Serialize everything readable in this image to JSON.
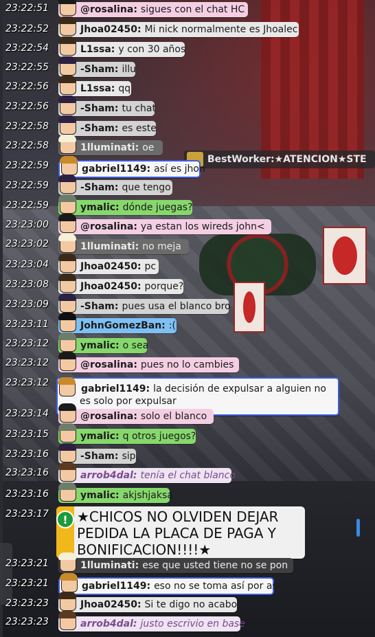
{
  "overlay": {
    "bestworker_name": "BestWorker:",
    "bestworker_msg": "★ATENCION★STE"
  },
  "rows": [
    {
      "time": "23:22:51",
      "name": "@rosalina:",
      "msg": "sigues con el chat HC",
      "style": "b-pink"
    },
    {
      "time": "23:22:52",
      "name": "Jhoa02450:",
      "msg": "Mi nick normalmente es Jhoalec",
      "style": "b-lgrey"
    },
    {
      "time": "23:22:54",
      "name": "L1ssa:",
      "msg": "y con 30 años",
      "style": "b-lgrey"
    },
    {
      "time": "23:22:55",
      "name": "-Sham:",
      "msg": "illu",
      "style": "b-grey"
    },
    {
      "time": "23:22:56",
      "name": "L1ssa:",
      "msg": "qq",
      "style": "b-lgrey"
    },
    {
      "time": "23:22:56",
      "name": "-Sham:",
      "msg": "tu chat",
      "style": "b-grey"
    },
    {
      "time": "23:22:58",
      "name": "-Sham:",
      "msg": "es este",
      "style": "b-grey"
    },
    {
      "time": "23:22:58",
      "name": "1lluminati:",
      "msg": "oe",
      "style": "b-dark"
    },
    {
      "time": "23:22:59",
      "name": "gabriel1149:",
      "msg": "así es jhon",
      "style": "b-white"
    },
    {
      "time": "23:22:59",
      "name": "-Sham:",
      "msg": "que tengo",
      "style": "b-grey"
    },
    {
      "time": "23:22:59",
      "name": "ymalic:",
      "msg": "dónde juegas?",
      "style": "b-green"
    },
    {
      "time": "23:23:00",
      "name": "@rosalina:",
      "msg": "ya estan los wireds john<",
      "style": "b-pink"
    },
    {
      "time": "23:23:02",
      "name": "1lluminati:",
      "msg": "no meja",
      "style": "b-dark"
    },
    {
      "time": "23:23:04",
      "name": "Jhoa02450:",
      "msg": "pc",
      "style": "b-lgrey"
    },
    {
      "time": "23:23:08",
      "name": "Jhoa02450:",
      "msg": "porque?",
      "style": "b-lgrey"
    },
    {
      "time": "23:23:09",
      "name": "-Sham:",
      "msg": "pues usa el blanco bro",
      "style": "b-grey"
    },
    {
      "time": "23:23:11",
      "name": "JohnGomezBan:",
      "msg": ":(",
      "style": "b-blue"
    },
    {
      "time": "23:23:12",
      "name": "ymalic:",
      "msg": "o sea",
      "style": "b-green"
    },
    {
      "time": "23:23:12",
      "name": "@rosalina:",
      "msg": "pues no lo cambies",
      "style": "b-pink"
    },
    {
      "time": "23:23:12",
      "name": "gabriel1149:",
      "msg": "la decisión de expulsar a alguien no es solo por expulsar",
      "style": "b-white"
    },
    {
      "time": "23:23:14",
      "name": "@rosalina:",
      "msg": "solo el blanco",
      "style": "b-pink"
    },
    {
      "time": "23:23:15",
      "name": "ymalic:",
      "msg": "q otros juegos?",
      "style": "b-green"
    },
    {
      "time": "23:23:16",
      "name": "-Sham:",
      "msg": "sip",
      "style": "b-grey"
    },
    {
      "time": "23:23:16",
      "name": "arrob4dal:",
      "msg": "tenía el chat blanco",
      "style": "b-purple-ital"
    },
    {
      "time": "23:23:16",
      "name": "ymalic:",
      "msg": "akjshjaksa",
      "style": "b-green"
    },
    {
      "time": "23:23:17",
      "name": "",
      "msg": "★CHICOS NO OLVIDEN DEJAR PEDIDA LA PLACA DE PAGA Y BONIFICACION!!!!★",
      "style": "alert"
    },
    {
      "time": "23:23:21",
      "name": "1lluminati:",
      "msg": "ese que usted tiene no se pon",
      "style": "b-dark2"
    },
    {
      "time": "23:23:21",
      "name": "gabriel1149:",
      "msg": "eso no se toma así por así",
      "style": "b-white"
    },
    {
      "time": "23:23:23",
      "name": "Jhoa02450:",
      "msg": "Si te digo no acabo",
      "style": "b-lgrey"
    },
    {
      "time": "23:23:23",
      "name": "arrob4dal:",
      "msg": "justo escrivio en base",
      "style": "b-purple-ital"
    }
  ]
}
